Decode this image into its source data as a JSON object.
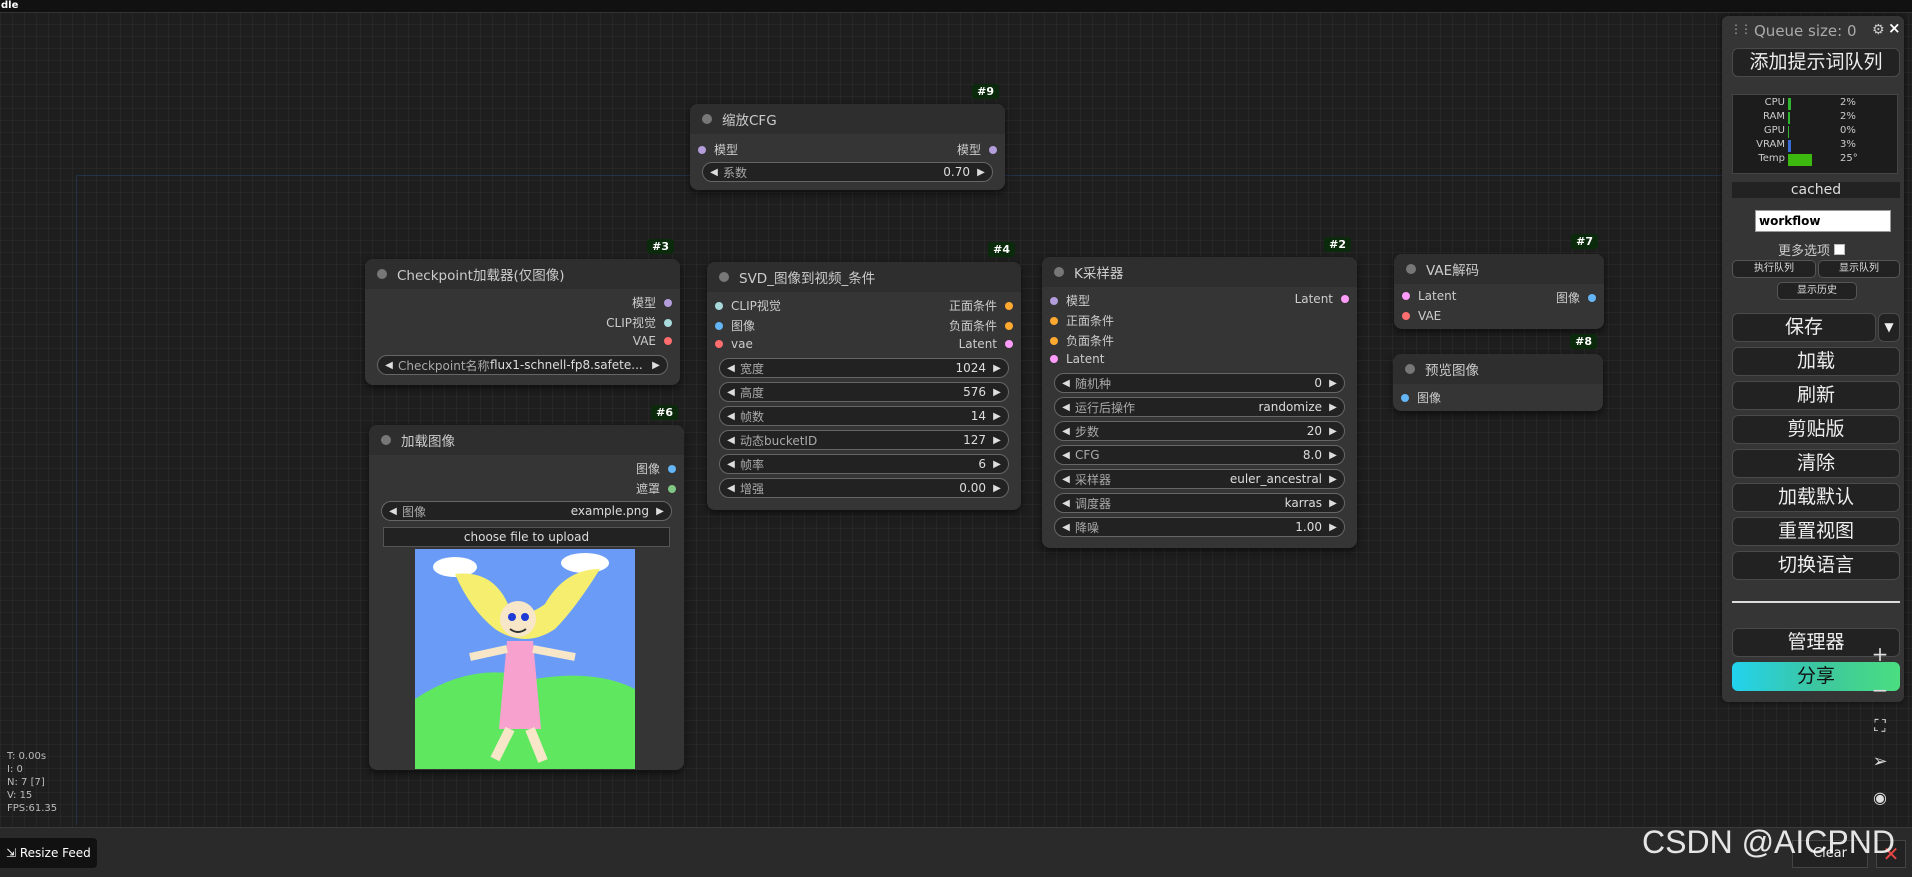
{
  "app": {
    "title_fragment": "dle"
  },
  "nodes": {
    "scalecfg": {
      "id": "#9",
      "title": "缩放CFG",
      "in_model": "模型",
      "out_model": "模型",
      "w_label": "系数",
      "w_value": "0.70"
    },
    "checkpoint": {
      "id": "#3",
      "title": "Checkpoint加载器(仅图像)",
      "out_model": "模型",
      "out_clip": "CLIP视觉",
      "out_vae": "VAE",
      "w_label": "Checkpoint名称",
      "w_value": "flux1-schnell-fp8.safete..."
    },
    "loadimage": {
      "id": "#6",
      "title": "加载图像",
      "out_image": "图像",
      "out_mask": "遮罩",
      "w_label": "图像",
      "w_value": "example.png",
      "upload": "choose file to upload"
    },
    "svd": {
      "id": "#4",
      "title": "SVD_图像到视频_条件",
      "in_clip": "CLIP视觉",
      "in_image": "图像",
      "in_vae": "vae",
      "out_pos": "正面条件",
      "out_neg": "负面条件",
      "out_latent": "Latent",
      "widgets": [
        {
          "label": "宽度",
          "value": "1024"
        },
        {
          "label": "高度",
          "value": "576"
        },
        {
          "label": "帧数",
          "value": "14"
        },
        {
          "label": "动态bucketID",
          "value": "127"
        },
        {
          "label": "帧率",
          "value": "6"
        },
        {
          "label": "增强",
          "value": "0.00"
        }
      ]
    },
    "ksampler": {
      "id": "#2",
      "title": "K采样器",
      "in_model": "模型",
      "in_pos": "正面条件",
      "in_neg": "负面条件",
      "in_latent": "Latent",
      "out_latent": "Latent",
      "widgets": [
        {
          "label": "随机种",
          "value": "0"
        },
        {
          "label": "运行后操作",
          "value": "randomize"
        },
        {
          "label": "步数",
          "value": "20"
        },
        {
          "label": "CFG",
          "value": "8.0"
        },
        {
          "label": "采样器",
          "value": "euler_ancestral"
        },
        {
          "label": "调度器",
          "value": "karras"
        },
        {
          "label": "降噪",
          "value": "1.00"
        }
      ]
    },
    "vaedecode": {
      "id": "#7",
      "title": "VAE解码",
      "in_latent": "Latent",
      "in_vae": "VAE",
      "out_image": "图像"
    },
    "preview": {
      "id": "#8",
      "title": "预览图像",
      "in_image": "图像"
    }
  },
  "slot_colors": {
    "model": "#b39ddb",
    "clip_vision": "#a8dadc",
    "vae": "#ff6e6e",
    "image": "#64b5f6",
    "mask": "#81c784",
    "conditioning": "#ffa931",
    "latent": "#ff9cf9"
  },
  "panel": {
    "queue_size": "Queue size: 0",
    "queue_prompt": "添加提示词队列",
    "monitor": [
      {
        "label": "CPU",
        "value": "2%",
        "pct": 2,
        "color": "#2fb52f"
      },
      {
        "label": "RAM",
        "value": "2%",
        "pct": 2,
        "color": "#2fb52f"
      },
      {
        "label": "GPU",
        "value": "0%",
        "pct": 0,
        "color": "#2fb52f"
      },
      {
        "label": "VRAM",
        "value": "3%",
        "pct": 3,
        "color": "#3a6bd6"
      },
      {
        "label": "Temp",
        "value": "25°",
        "pct": 50,
        "color": "#3cb80e"
      }
    ],
    "cached": "cached",
    "workflow": "workflow",
    "more_options": "更多选项",
    "view_queue": "执行队列",
    "show_queue": "显示队列",
    "view_history": "显示历史",
    "save": "保存",
    "save_dropdown": "▼",
    "load": "加载",
    "refresh": "刷新",
    "clipspace": "剪贴版",
    "clear": "清除",
    "load_default": "加载默认",
    "reset_view": "重置视图",
    "switch_lang": "切换语言",
    "manager": "管理器",
    "share": "分享"
  },
  "stats": {
    "t": "T: 0.00s",
    "i": "I: 0",
    "n": "N: 7 [7]",
    "v": "V: 15",
    "fps": "FPS:61.35"
  },
  "bottom": {
    "resize_feed": "Resize Feed",
    "clear": "Clear",
    "clear_x": "✕"
  },
  "watermark": "CSDN @AICPND"
}
